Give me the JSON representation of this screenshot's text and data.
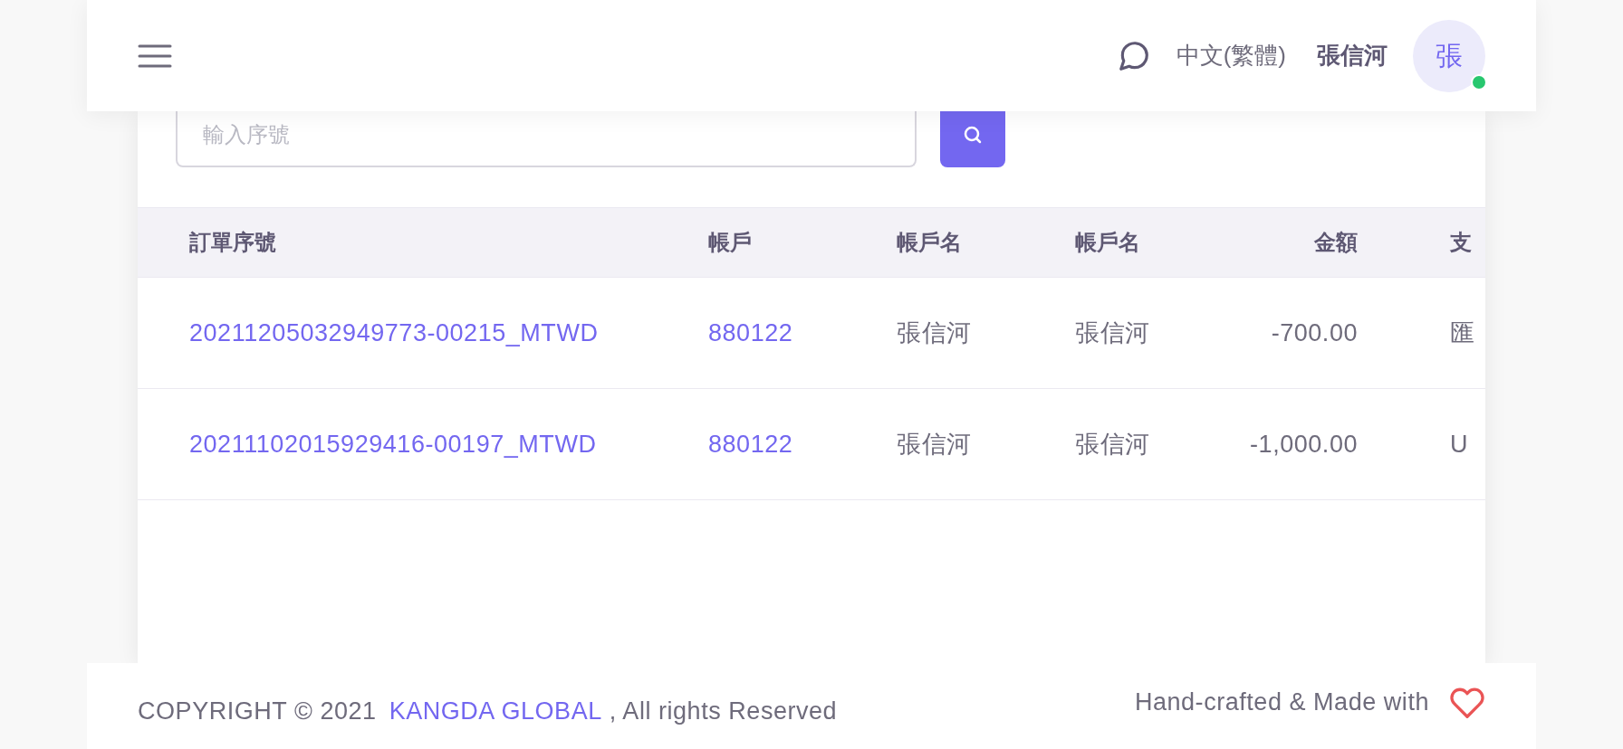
{
  "navbar": {
    "language": "中文(繁體)",
    "user_name": "張信河",
    "avatar_initial": "張",
    "online": true
  },
  "search": {
    "placeholder": "輸入序號"
  },
  "table": {
    "columns": [
      "訂單序號",
      "帳戶",
      "帳戶名",
      "帳戶名",
      "金額",
      "支"
    ],
    "rows": [
      {
        "cells": [
          "20211205032949773-00215_MTWD",
          "880122",
          "張信河",
          "張信河",
          "-700.00",
          "匯"
        ]
      },
      {
        "cells": [
          "20211102015929416-00197_MTWD",
          "880122",
          "張信河",
          "張信河",
          "-1,000.00",
          "U"
        ]
      }
    ]
  },
  "footer": {
    "copyright_prefix": "COPYRIGHT © 2021",
    "company": "KANGDA GLOBAL",
    "copyright_suffix": ", All rights Reserved",
    "made_with": "Hand-crafted & Made with"
  }
}
